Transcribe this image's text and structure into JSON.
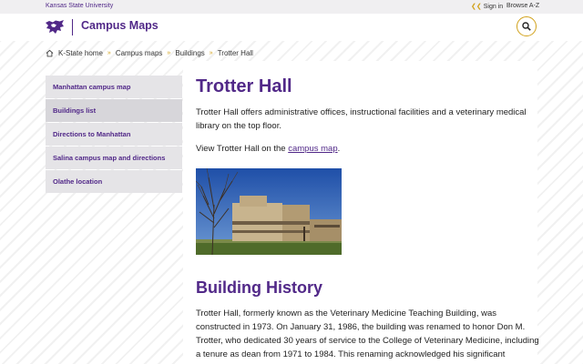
{
  "topbar": {
    "university": "Kansas State University",
    "sign_in": "Sign in",
    "browse": "Browse A-Z"
  },
  "header": {
    "site_title": "Campus Maps"
  },
  "breadcrumb": [
    "K-State home",
    "Campus maps",
    "Buildings",
    "Trotter Hall"
  ],
  "sidenav": [
    "Manhattan campus map",
    "Buildings list",
    "Directions to Manhattan",
    "Salina campus map and directions",
    "Olathe location"
  ],
  "main": {
    "title": "Trotter Hall",
    "intro": "Trotter Hall offers administrative offices, instructional facilities and a veterinary medical library on the top floor.",
    "view_prefix": "View Trotter Hall on the ",
    "view_link": "campus map",
    "view_suffix": ".",
    "history_title": "Building History",
    "history_text": "Trotter Hall, formerly known as the Veterinary Medicine Teaching Building, was constructed in 1973. On January 31, 1986, the building was renamed to honor Don M. Trotter, who dedicated 30 years of service to the College of Veterinary Medicine, including a tenure as dean from 1971 to 1984. This renaming acknowledged his significant"
  },
  "colors": {
    "brand_purple": "#512888",
    "accent_gold": "#d1a11a"
  },
  "icons": [
    "wildcat-logo-icon",
    "search-icon",
    "home-icon",
    "sign-in-arrow-icon",
    "chevron-right-icon"
  ]
}
